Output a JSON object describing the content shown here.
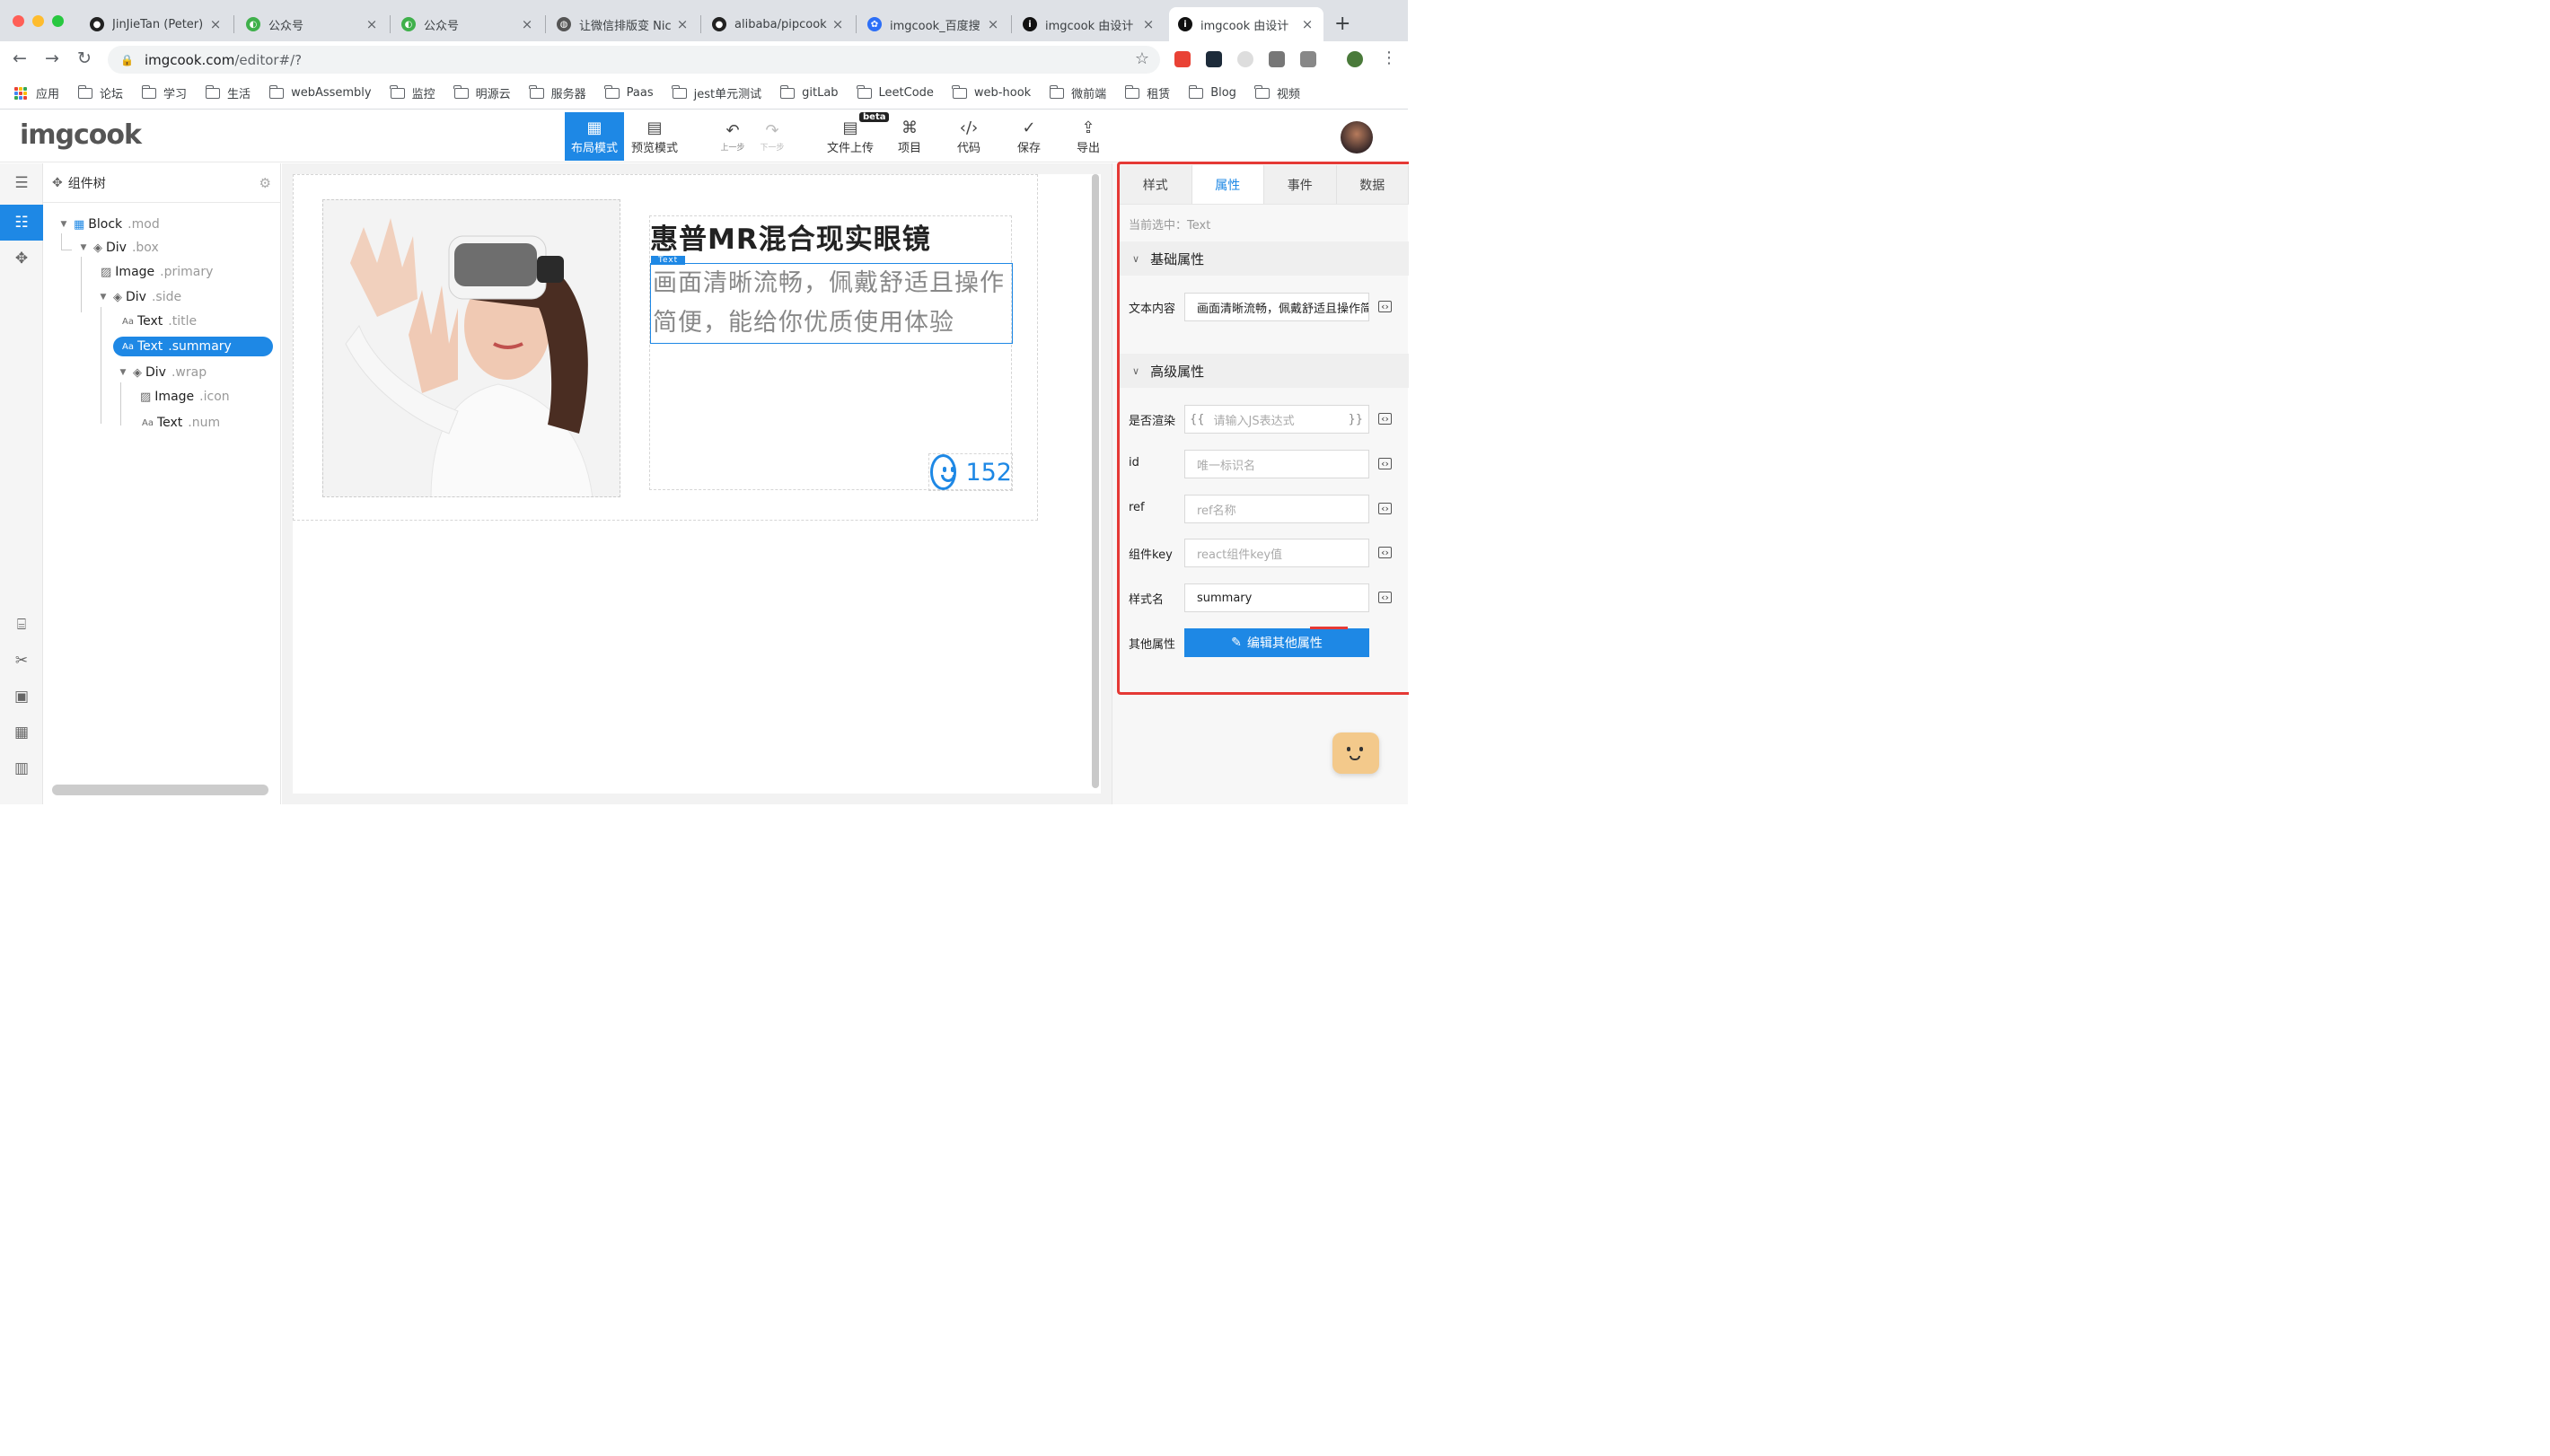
{
  "browser": {
    "tabs": [
      {
        "label": "JinJieTan (Peter)",
        "icon": "github-icon"
      },
      {
        "label": "公众号",
        "icon": "wechat-icon"
      },
      {
        "label": "公众号",
        "icon": "wechat-icon"
      },
      {
        "label": "让微信排版变 Nic",
        "icon": "globe-icon"
      },
      {
        "label": "alibaba/pipcook",
        "icon": "github-icon"
      },
      {
        "label": "imgcook_百度搜",
        "icon": "baidu-icon"
      },
      {
        "label": "imgcook 由设计",
        "icon": "info-icon"
      },
      {
        "label": "imgcook 由设计",
        "icon": "info-icon"
      }
    ],
    "new_tab": "+",
    "url_host": "imgcook.com",
    "url_path": "/editor#/?",
    "bookmarks": [
      "应用",
      "论坛",
      "学习",
      "生活",
      "webAssembly",
      "监控",
      "明源云",
      "服务器",
      "Paas",
      "jest单元测试",
      "gitLab",
      "LeetCode",
      "web-hook",
      "微前端",
      "租赁",
      "Blog",
      "视频"
    ]
  },
  "app": {
    "logo": "imgcook",
    "toolbar": {
      "layout_mode": "布局模式",
      "preview_mode": "预览模式",
      "undo": "上一步",
      "redo": "下一步",
      "upload": "文件上传",
      "beta": "beta",
      "project": "项目",
      "code": "代码",
      "save": "保存",
      "export": "导出"
    }
  },
  "tree": {
    "title": "组件树",
    "nodes": [
      {
        "name": "Block",
        "cls": ".mod"
      },
      {
        "name": "Div",
        "cls": ".box"
      },
      {
        "name": "Image",
        "cls": ".primary"
      },
      {
        "name": "Div",
        "cls": ".side"
      },
      {
        "name": "Text",
        "cls": ".title"
      },
      {
        "name": "Text",
        "cls": ".summary"
      },
      {
        "name": "Div",
        "cls": ".wrap"
      },
      {
        "name": "Image",
        "cls": ".icon"
      },
      {
        "name": "Text",
        "cls": ".num"
      }
    ]
  },
  "canvas": {
    "title": "惠普MR混合现实眼镜",
    "summary": "画面清晰流畅，佩戴舒适且操作简便，能给你优质使用体验",
    "tag": "Text",
    "num": "152"
  },
  "props": {
    "tabs": [
      "样式",
      "属性",
      "事件",
      "数据"
    ],
    "current": "当前选中：Text",
    "basic_section": "基础属性",
    "advanced_section": "高级属性",
    "text_content_label": "文本内容",
    "text_content_value": "画面清晰流畅，佩戴舒适且操作简便，能给你优质使用体验",
    "render_label": "是否渲染",
    "render_placeholder": "请输入JS表达式",
    "brace_open": "{{",
    "brace_close": "}}",
    "id_label": "id",
    "id_placeholder": "唯一标识名",
    "ref_label": "ref",
    "ref_placeholder": "ref名称",
    "key_label": "组件key",
    "key_placeholder": "react组件key值",
    "class_label": "样式名",
    "class_value": "summary",
    "other_label": "其他属性",
    "edit_other": "编辑其他属性"
  }
}
